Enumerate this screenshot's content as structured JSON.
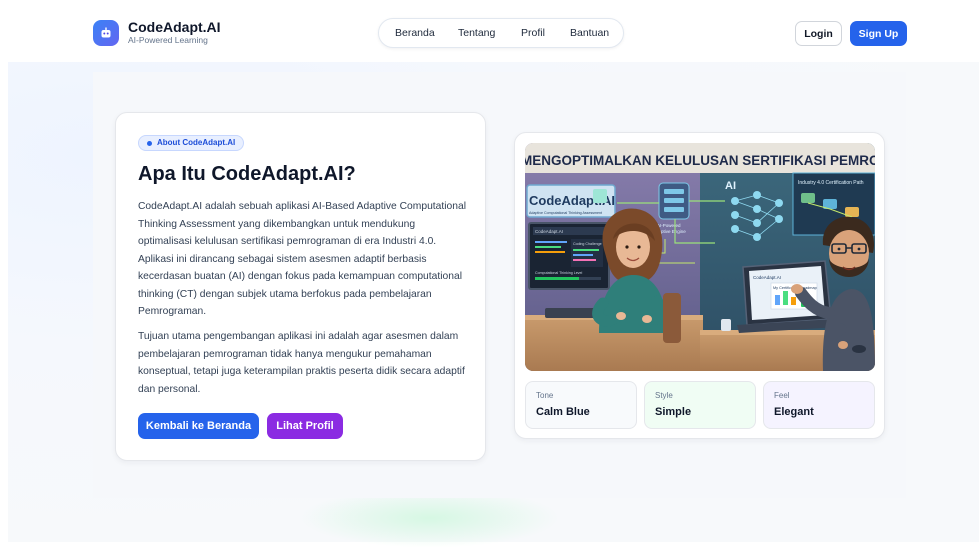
{
  "header": {
    "brand_name": "CodeAdapt.AI",
    "brand_tagline": "AI-Powered Learning",
    "nav": [
      "Beranda",
      "Tentang",
      "Profil",
      "Bantuan"
    ],
    "login_label": "Login",
    "signup_label": "Sign Up"
  },
  "about": {
    "badge": "About CodeAdapt.AI",
    "title": "Apa Itu CodeAdapt.AI?",
    "paragraphs": [
      "CodeAdapt.AI adalah sebuah aplikasi AI-Based Adaptive Computational Thinking Assessment yang dikembangkan untuk mendukung optimalisasi kelulusan sertifikasi pemrograman di era Industri 4.0. Aplikasi ini dirancang sebagai sistem asesmen adaptif berbasis kecerdasan buatan (AI) dengan fokus pada kemampuan computational thinking (CT) dengan subjek utama berfokus pada pembelajaran Pemrograman.",
      "Tujuan utama pengembangan aplikasi ini adalah agar asesmen dalam pembelajaran pemrograman tidak hanya mengukur pemahaman konseptual, tetapi juga keterampilan praktis peserta didik secara adaptif dan personal."
    ],
    "home_button": "Kembali ke Beranda",
    "profile_button": "Lihat Profil"
  },
  "illustration": {
    "banner": "MENGOPTIMALKAN KELULUSAN SERTIFIKASI PEMROGRAMAN",
    "sign_title": "CodeAdapt.AI",
    "sign_subtitle": "Adaptive Computational Thinking Assessment",
    "engine_label_1": "AI-Powered",
    "engine_label_2": "Adaptive Engine",
    "ai_label": "AI",
    "cert_label": "Industry 4.0 Certification Path",
    "laptop_title": "CodeAdapt.AI",
    "laptop_panel": "My Certification Roadmap",
    "monitor_title": "CodeAdapt.AI",
    "monitor_panel": "Coding Challenge",
    "monitor_bar": "Computational Thinking Level"
  },
  "traits": [
    {
      "label": "Tone",
      "value": "Calm Blue",
      "bg": "#f8fafc"
    },
    {
      "label": "Style",
      "value": "Simple",
      "bg": "#f0fdf4"
    },
    {
      "label": "Feel",
      "value": "Elegant",
      "bg": "#f5f3ff"
    }
  ]
}
